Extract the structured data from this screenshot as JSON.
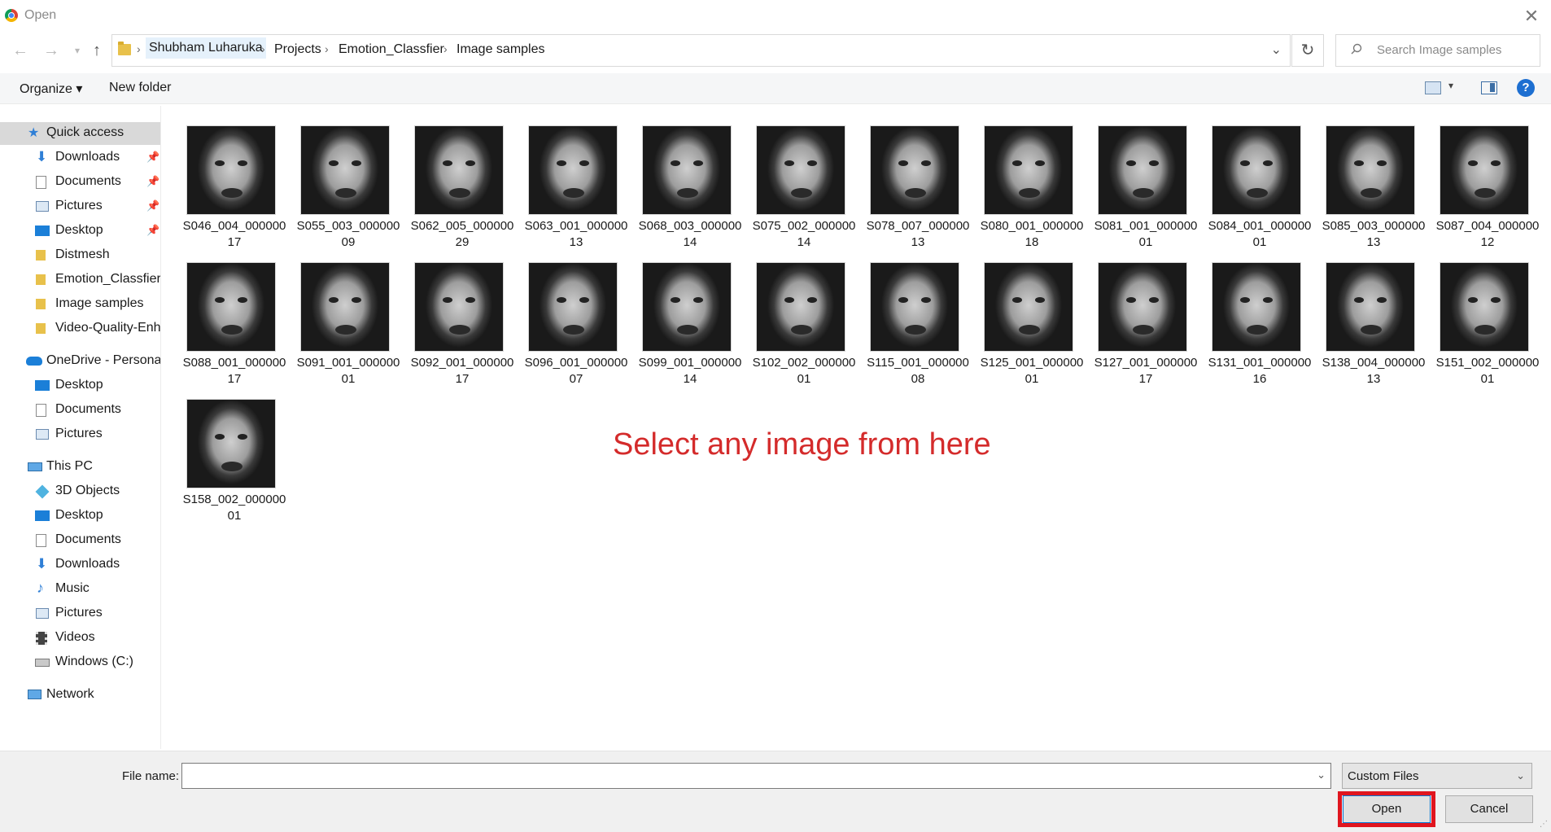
{
  "window": {
    "title": "Open"
  },
  "address": {
    "crumbs": [
      "Shubham Luharuka",
      "Projects",
      "Emotion_Classfier",
      "Image samples"
    ]
  },
  "search": {
    "placeholder": "Search Image samples"
  },
  "toolbar": {
    "organize": "Organize ▾",
    "new_folder": "New folder",
    "help": "?"
  },
  "sidebar": {
    "quick_access": "Quick access",
    "quick_items": [
      {
        "label": "Downloads",
        "icon": "download-icon",
        "pinned": true
      },
      {
        "label": "Documents",
        "icon": "documents-icon",
        "pinned": true
      },
      {
        "label": "Pictures",
        "icon": "pictures-icon",
        "pinned": true
      },
      {
        "label": "Desktop",
        "icon": "desktop-icon",
        "pinned": true
      },
      {
        "label": "Distmesh",
        "icon": "folder-icon",
        "pinned": false
      },
      {
        "label": "Emotion_Classfier",
        "icon": "folder-icon",
        "pinned": false
      },
      {
        "label": "Image samples",
        "icon": "folder-icon",
        "pinned": false
      },
      {
        "label": "Video-Quality-Enha",
        "icon": "folder-icon",
        "pinned": false
      }
    ],
    "onedrive": "OneDrive - Personal",
    "onedrive_items": [
      "Desktop",
      "Documents",
      "Pictures"
    ],
    "this_pc": "This PC",
    "pc_items": [
      "3D Objects",
      "Desktop",
      "Documents",
      "Downloads",
      "Music",
      "Pictures",
      "Videos",
      "Windows (C:)"
    ],
    "network": "Network"
  },
  "files": [
    {
      "line1": "S046_004_000000",
      "line2": "17"
    },
    {
      "line1": "S055_003_000000",
      "line2": "09"
    },
    {
      "line1": "S062_005_000000",
      "line2": "29"
    },
    {
      "line1": "S063_001_000000",
      "line2": "13"
    },
    {
      "line1": "S068_003_000000",
      "line2": "14"
    },
    {
      "line1": "S075_002_000000",
      "line2": "14"
    },
    {
      "line1": "S078_007_000000",
      "line2": "13"
    },
    {
      "line1": "S080_001_000000",
      "line2": "18"
    },
    {
      "line1": "S081_001_000000",
      "line2": "01"
    },
    {
      "line1": "S084_001_000000",
      "line2": "01"
    },
    {
      "line1": "S085_003_000000",
      "line2": "13"
    },
    {
      "line1": "S087_004_000000",
      "line2": "12"
    },
    {
      "line1": "S088_001_000000",
      "line2": "17"
    },
    {
      "line1": "S091_001_000000",
      "line2": "01"
    },
    {
      "line1": "S092_001_000000",
      "line2": "17"
    },
    {
      "line1": "S096_001_000000",
      "line2": "07"
    },
    {
      "line1": "S099_001_000000",
      "line2": "14"
    },
    {
      "line1": "S102_002_000000",
      "line2": "01"
    },
    {
      "line1": "S115_001_000000",
      "line2": "08"
    },
    {
      "line1": "S125_001_000000",
      "line2": "01"
    },
    {
      "line1": "S127_001_000000",
      "line2": "17"
    },
    {
      "line1": "S131_001_000000",
      "line2": "16"
    },
    {
      "line1": "S138_004_000000",
      "line2": "13"
    },
    {
      "line1": "S151_002_000000",
      "line2": "01"
    },
    {
      "line1": "S158_002_000000",
      "line2": "01"
    }
  ],
  "annotation": {
    "text": "Select any image from here",
    "color": "#d42b2b"
  },
  "footer": {
    "file_name_label": "File name:",
    "file_name_value": "",
    "filter_value": "Custom Files",
    "open_label": "Open",
    "cancel_label": "Cancel",
    "highlight_color": "#e0161f"
  }
}
